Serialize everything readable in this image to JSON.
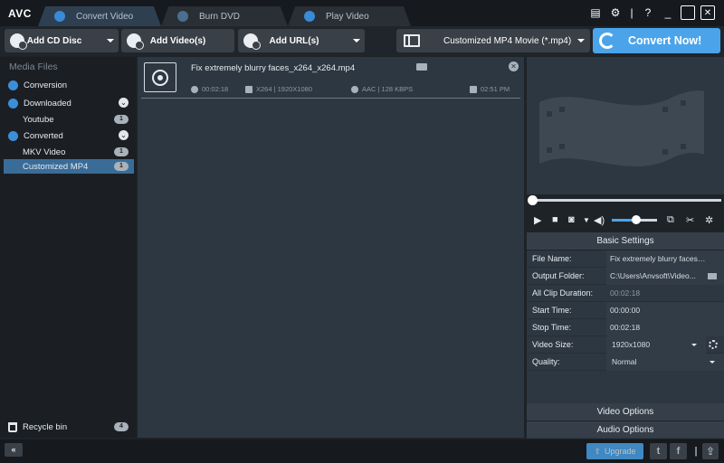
{
  "app": {
    "logo": "AVC"
  },
  "tabs": [
    {
      "label": "Convert Video",
      "active": true
    },
    {
      "label": "Burn DVD",
      "active": false
    },
    {
      "label": "Play Video",
      "active": false
    }
  ],
  "window_buttons": {
    "help": "?",
    "minimize": "_",
    "maximize": "□",
    "close": "✕"
  },
  "toolbar": {
    "add_cd_disc": "Add CD Disc",
    "add_videos": "Add Video(s)",
    "add_urls": "Add URL(s)",
    "profile": "Customized MP4 Movie (*.mp4)",
    "convert_now": "Convert Now!"
  },
  "sidebar": {
    "header": "Media Files",
    "items": [
      {
        "label": "Conversion"
      },
      {
        "label": "Downloaded"
      },
      {
        "label": "Youtube",
        "count": "1"
      },
      {
        "label": "Converted"
      },
      {
        "label": "MKV Video",
        "count": "1"
      },
      {
        "label": "Customized MP4",
        "count": "1",
        "selected": true
      }
    ],
    "recycle": {
      "label": "Recycle bin",
      "count": "4"
    }
  },
  "file": {
    "name": "Fix extremely blurry faces_x264_x264.mp4",
    "duration": "00:02:18",
    "video": "X264 | 1920X1080",
    "audio": "AAC | 128 KBPS",
    "time": "02:51 PM"
  },
  "settings": {
    "header": "Basic Settings",
    "rows": [
      {
        "key": "File Name:",
        "value": "Fix extremely blurry faces_..."
      },
      {
        "key": "Output Folder:",
        "value": "C:\\Users\\Anvsoft\\Video..."
      },
      {
        "key": "All Clip Duration:",
        "value": "00:02:18"
      },
      {
        "key": "Start Time:",
        "value": "00:00:00"
      },
      {
        "key": "Stop Time:",
        "value": "00:02:18"
      },
      {
        "key": "Video Size:",
        "value": "1920x1080"
      },
      {
        "key": "Quality:",
        "value": "Normal"
      }
    ],
    "video_options": "Video Options",
    "audio_options": "Audio Options"
  },
  "player": {
    "volume_percent": 55
  },
  "bottom": {
    "collapse": "«",
    "upgrade": "Upgrade",
    "twitter": "t",
    "facebook": "f"
  },
  "colors": {
    "accent": "#4ba4ea",
    "selection": "#3a6c98",
    "panel": "#2d3741"
  }
}
